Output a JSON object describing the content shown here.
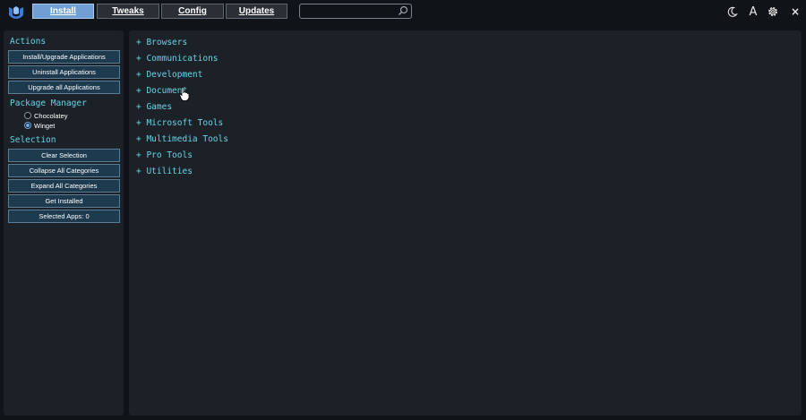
{
  "colors": {
    "accent": "#67d4ea",
    "active_tab": "#6f9fd3",
    "button_bg": "#1d3a4e",
    "panel_bg": "#1b2126",
    "window_bg": "#101418"
  },
  "header": {
    "logo_icon": "winutil-logo-icon",
    "tabs": [
      {
        "label": "Install",
        "active": true
      },
      {
        "label": "Tweaks",
        "active": false
      },
      {
        "label": "Config",
        "active": false
      },
      {
        "label": "Updates",
        "active": false
      }
    ],
    "search": {
      "value": "",
      "placeholder": ""
    },
    "icons": [
      "moon-icon",
      "font-size-icon",
      "gear-icon",
      "close-icon"
    ],
    "font_icon_text": "A",
    "close_text": "×"
  },
  "sidebar": {
    "actions_title": "Actions",
    "actions": [
      "Install/Upgrade Applications",
      "Uninstall Applications",
      "Upgrade all Applications"
    ],
    "package_manager_title": "Package Manager",
    "package_managers": [
      {
        "label": "Chocolatey",
        "selected": false
      },
      {
        "label": "Winget",
        "selected": true
      }
    ],
    "selection_title": "Selection",
    "selection_buttons": [
      "Clear Selection",
      "Collapse All Categories",
      "Expand All Categories",
      "Get Installed",
      "Selected Apps: 0"
    ]
  },
  "main": {
    "categories": [
      "+ Browsers",
      "+ Communications",
      "+ Development",
      "+ Document",
      "+ Games",
      "+ Microsoft Tools",
      "+ Multimedia Tools",
      "+ Pro Tools",
      "+ Utilities"
    ]
  }
}
